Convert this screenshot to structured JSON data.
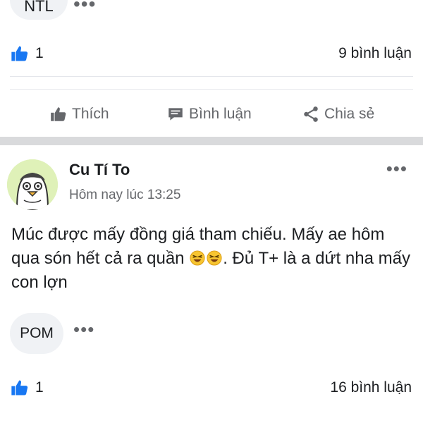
{
  "previous_post": {
    "tag_label": "NTL",
    "likes": "1",
    "comments": "9 bình luận",
    "actions": {
      "like": "Thích",
      "comment": "Bình luận",
      "share": "Chia sẻ"
    }
  },
  "post": {
    "author": "Cu Tí To",
    "timestamp": "Hôm nay lúc 13:25",
    "text_part1": "Múc được mấy đồng giá tham chiếu. Mấy ae hôm qua són hết cả ra quần ",
    "text_part2": ". Đủ T+ là a dứt nha mấy con lợn",
    "tag_label": "POM",
    "likes": "1",
    "comments": "16 bình luận",
    "more_dots": "•••"
  },
  "icons": {
    "like": "thumbs-up-icon",
    "comment": "comment-bubble-icon",
    "share": "share-icon",
    "emoji": "laughing-emoji-icon",
    "more": "more-dots-icon"
  },
  "colors": {
    "like_blue": "#1877f2",
    "muted_text": "#65676b",
    "separator": "#d9dadc",
    "chip_bg": "#f0f2f5"
  }
}
